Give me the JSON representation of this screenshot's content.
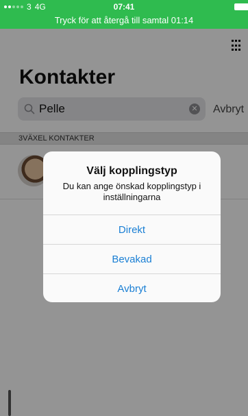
{
  "status_bar": {
    "carrier": "3",
    "network": "4G",
    "time": "07:41",
    "call_banner": "Tryck för att återgå till samtal 01:14",
    "color": "#2fbb4f"
  },
  "header": {
    "title": "Kontakter"
  },
  "search": {
    "value": "Pelle",
    "cancel_label": "Avbryt"
  },
  "contacts": {
    "section_label": "3VÄXEL KONTAKTER"
  },
  "alert": {
    "title": "Välj kopplingstyp",
    "message": "Du kan ange önskad kopplingstyp i inställningarna",
    "buttons": {
      "direct": "Direkt",
      "supervised": "Bevakad",
      "cancel": "Avbryt"
    },
    "accent": "#1a7fd4"
  },
  "icons": [
    "search-icon",
    "clear-icon",
    "dialpad-icon",
    "avatar"
  ]
}
